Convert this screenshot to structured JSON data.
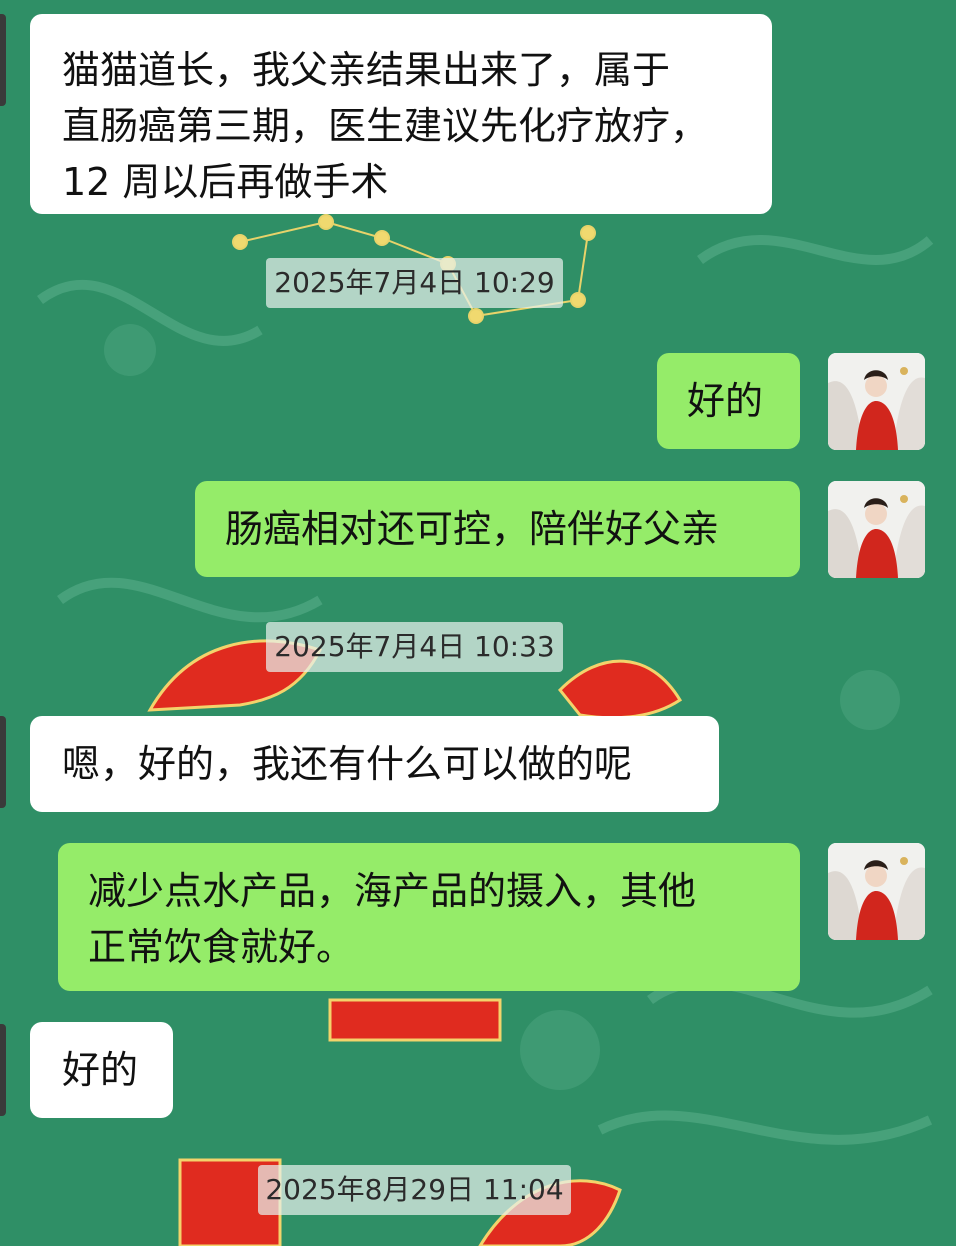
{
  "chat": {
    "messages": [
      {
        "side": "incoming",
        "text": "猫猫道长，我父亲结果出来了，属于\n直肠癌第三期，医生建议先化疗放疗，\n12 周以后再做手术"
      },
      {
        "side": "outgoing",
        "text": "好的"
      },
      {
        "side": "outgoing",
        "text": "肠癌相对还可控，陪伴好父亲"
      },
      {
        "side": "incoming",
        "text": "嗯，好的，我还有什么可以做的呢"
      },
      {
        "side": "outgoing",
        "text": "减少点水产品，海产品的摄入，其他\n正常饮食就好。"
      },
      {
        "side": "incoming",
        "text": "好的"
      }
    ],
    "timestamps": [
      "2025年7月4日 10:29",
      "2025年7月4日 10:33",
      "2025年8月29日 11:04"
    ]
  },
  "colors": {
    "background": "#2f8f66",
    "incoming_bubble": "#ffffff",
    "outgoing_bubble": "#95ec69",
    "timestamp_chip": "#e6f0eb"
  }
}
